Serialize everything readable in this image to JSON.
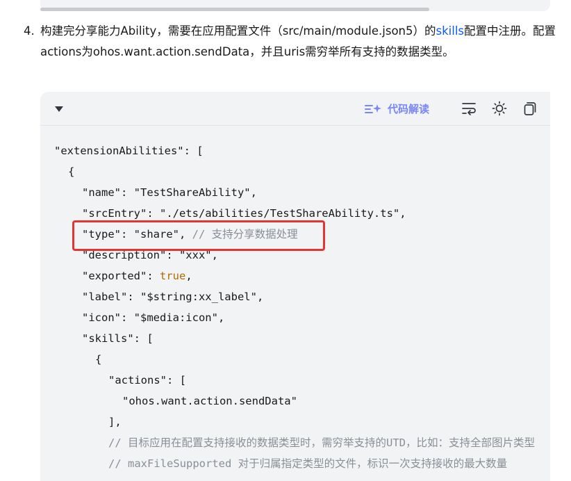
{
  "step": {
    "number": "4.",
    "text_before_link": "构建完分享能力Ability，需要在应用配置文件（src/main/module.json5）的",
    "link_text": "skills",
    "text_after_link": "配置中注册。配置actions为ohos.want.action.sendData，并且uris需穷举所有支持的数据类型。"
  },
  "toolbar": {
    "ai_explain_label": "代码解读"
  },
  "icons": {
    "collapse": "chevron-down-icon",
    "ai_explain": "sparkle-list-icon",
    "wrap": "wrap-lines-icon",
    "theme": "sun-icon",
    "copy": "copy-icon"
  },
  "colors": {
    "link": "#0a59f7",
    "ai_accent": "#7886f8",
    "highlight_border": "#e63434",
    "keyword_true": "#b06b00",
    "comment": "#8a8f96"
  },
  "code": {
    "l1": "\"extensionAbilities\": [",
    "l2": "{",
    "l3": "\"name\": \"TestShareAbility\",",
    "l4": "\"srcEntry\": \"./ets/abilities/TestShareAbility.ts\",",
    "l5a": "\"type\": \"share\", ",
    "l5b": "// 支持分享数据处理",
    "l6": "\"description\": \"xxx\",",
    "l7a": "\"exported\": ",
    "l7b": "true",
    "l7c": ",",
    "l8": "\"label\": \"$string:xx_label\",",
    "l9": "\"icon\": \"$media:icon\",",
    "l10": "\"skills\": [",
    "l11": "{",
    "l12": "\"actions\": [",
    "l13": "\"ohos.want.action.sendData\"",
    "l14": "],",
    "l15": "// 目标应用在配置支持接收的数据类型时，需穷举支持的UTD，比如：支持全部图片类型",
    "l16": "// maxFileSupported 对于归属指定类型的文件，标识一次支持接收的最大数量"
  }
}
